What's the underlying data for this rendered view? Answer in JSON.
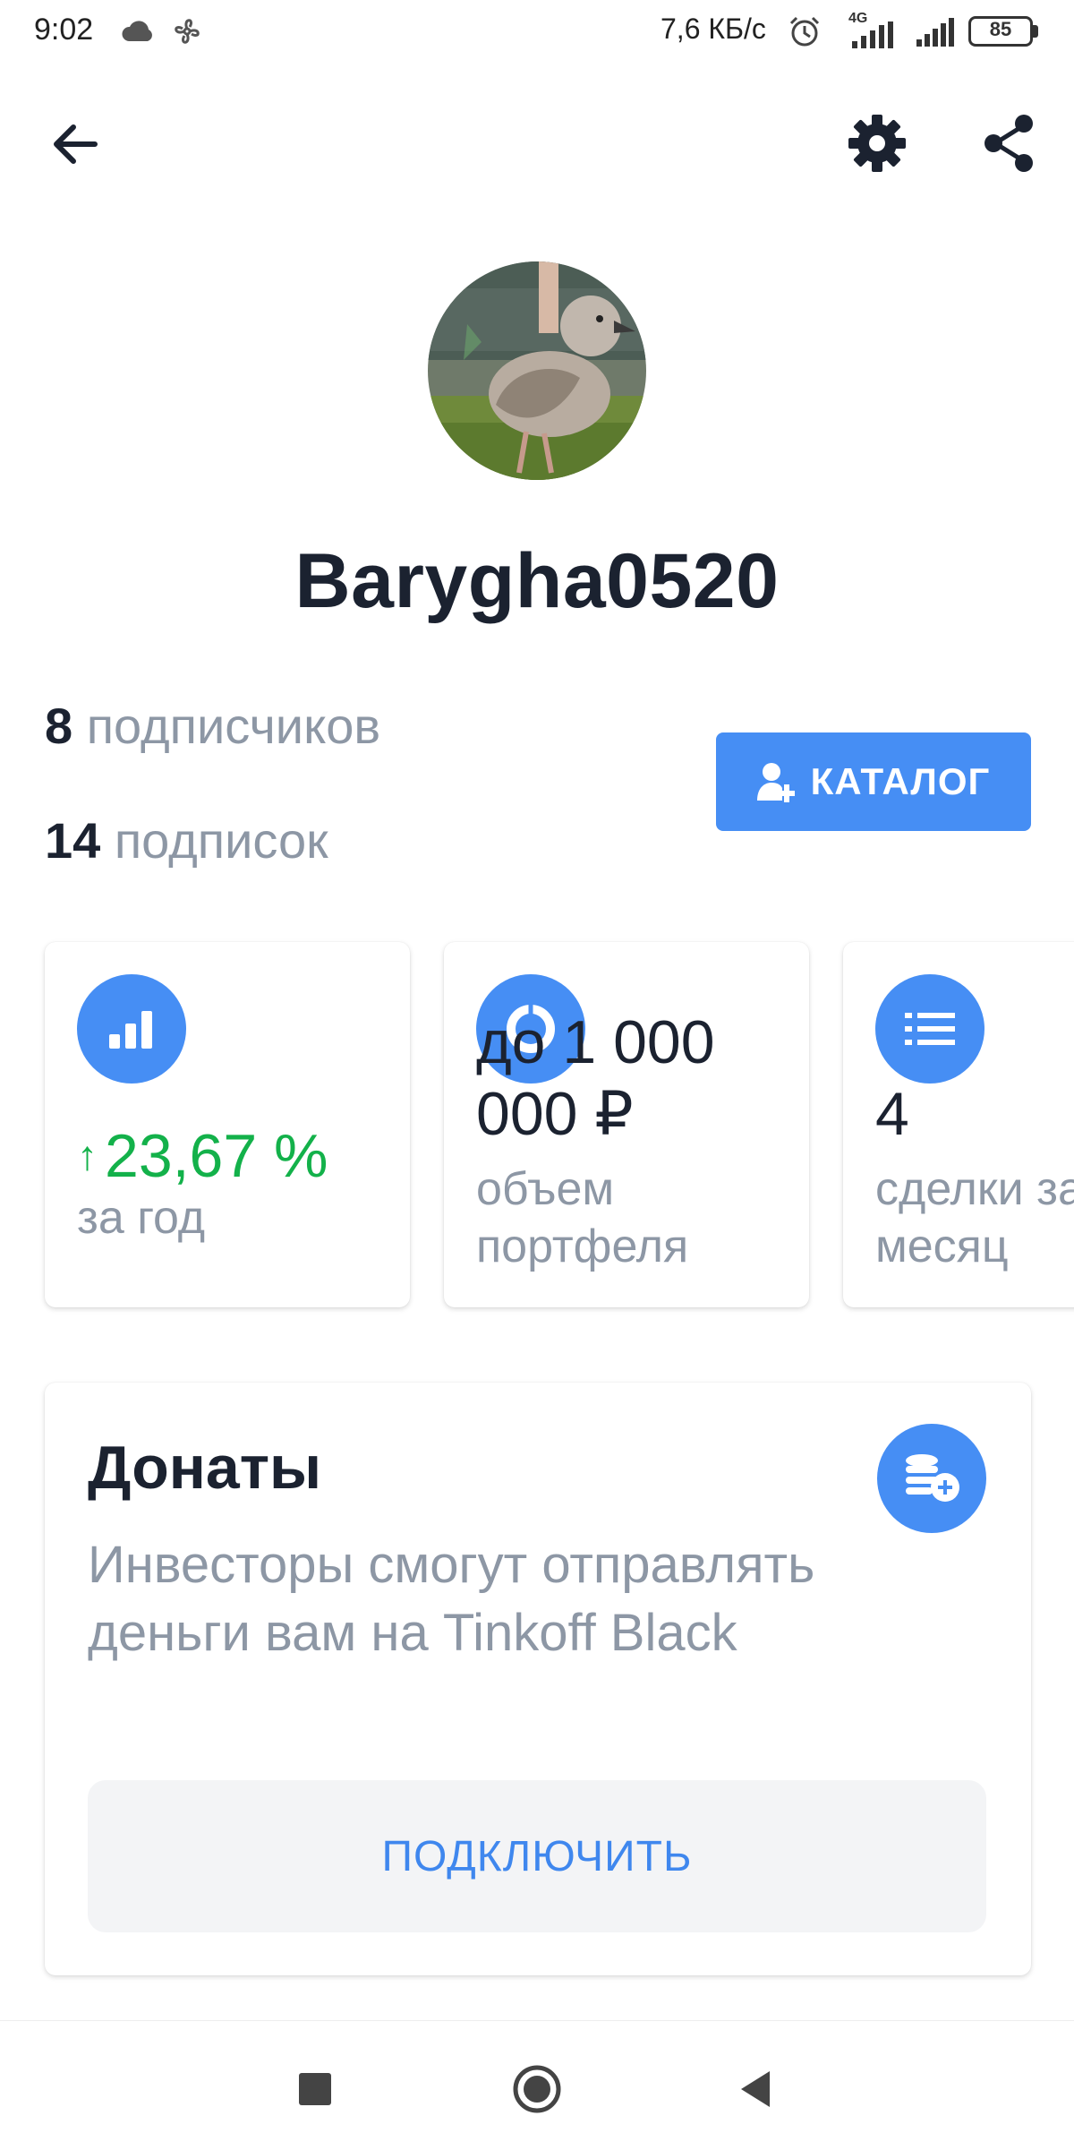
{
  "status_bar": {
    "time": "9:02",
    "network_speed": "7,6 КБ/с",
    "network_type": "4G",
    "battery": "85",
    "icons": [
      "cloud-icon",
      "fan-icon",
      "alarm-icon",
      "signal-icon",
      "battery-icon"
    ]
  },
  "toolbar": {
    "icons": [
      "back-arrow-icon",
      "gear-icon",
      "share-icon"
    ]
  },
  "profile": {
    "username": "Barygha0520",
    "subscribers_count": "8",
    "subscribers_label": "подписчиков",
    "subscriptions_count": "14",
    "subscriptions_label": "подписок",
    "catalog_button": "КАТАЛОГ"
  },
  "metrics": [
    {
      "icon": "bar-chart-icon",
      "value": "23,67 %",
      "label": "за год",
      "trend": "up"
    },
    {
      "icon": "pie-chart-icon",
      "value": "до 1 000 000 ₽",
      "label": "объем портфеля"
    },
    {
      "icon": "list-icon",
      "value": "4",
      "label": "сделки за месяц"
    }
  ],
  "donations": {
    "title": "Донаты",
    "description": "Инвесторы смогут отправлять деньги вам на Tinkoff Black",
    "button": "ПОДКЛЮЧИТЬ",
    "icon": "coins-plus-icon"
  },
  "colors": {
    "accent": "#468ef4",
    "positive": "#13b14a",
    "text_primary": "#1b2230",
    "text_secondary": "#8d97a5"
  }
}
